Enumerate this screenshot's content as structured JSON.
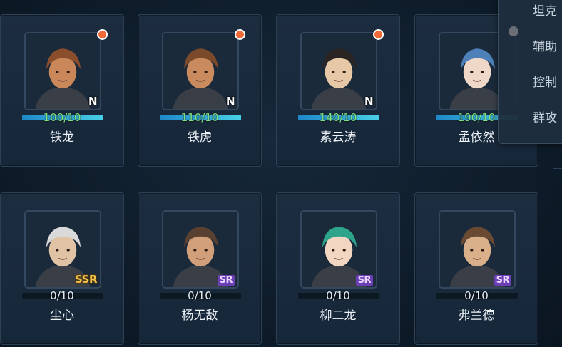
{
  "roster": {
    "row1": [
      {
        "name": "铁龙",
        "progress": "100/10",
        "rarity": "N",
        "has_notification": true,
        "progress_fraction": 1.0,
        "skin": "#c9875a",
        "hair": "#8a4e2c"
      },
      {
        "name": "铁虎",
        "progress": "110/10",
        "rarity": "N",
        "has_notification": true,
        "progress_fraction": 1.0,
        "skin": "#c98a5e",
        "hair": "#7a4a2a"
      },
      {
        "name": "素云涛",
        "progress": "140/10",
        "rarity": "N",
        "has_notification": true,
        "progress_fraction": 1.0,
        "skin": "#e6c7a6",
        "hair": "#2a2422"
      },
      {
        "name": "孟依然",
        "progress": "190/10",
        "rarity": "",
        "has_notification": false,
        "progress_fraction": 1.0,
        "skin": "#f0d8c8",
        "hair": "#4d7fb8"
      }
    ],
    "row2": [
      {
        "name": "尘心",
        "progress": "0/10",
        "rarity": "SSR",
        "has_notification": false,
        "progress_fraction": 0.0,
        "skin": "#e0c2a4",
        "hair": "#d9d9d9"
      },
      {
        "name": "杨无敌",
        "progress": "0/10",
        "rarity": "SR",
        "has_notification": false,
        "progress_fraction": 0.0,
        "skin": "#d1a07a",
        "hair": "#5a4030"
      },
      {
        "name": "柳二龙",
        "progress": "0/10",
        "rarity": "SR",
        "has_notification": false,
        "progress_fraction": 0.0,
        "skin": "#f2d6c2",
        "hair": "#2ea58a"
      },
      {
        "name": "弗兰德",
        "progress": "0/10",
        "rarity": "SR",
        "has_notification": false,
        "progress_fraction": 0.0,
        "skin": "#d9b08a",
        "hair": "#6a4a32"
      }
    ]
  },
  "filter_menu": {
    "items": [
      "坦克",
      "辅助",
      "控制",
      "群攻"
    ]
  },
  "colors": {
    "notification_dot": "#f26a38",
    "progress_full_text": "#7fe07f",
    "progress_empty_text": "#e6edf3",
    "bar_fill": "#48d0e6",
    "ssr_badge": "#f3c24a",
    "sr_badge": "#6b3fb5"
  },
  "icons": {
    "portrait": "character-portrait-icon",
    "notification": "notification-dot-icon",
    "filter_radio": "radio-icon"
  }
}
